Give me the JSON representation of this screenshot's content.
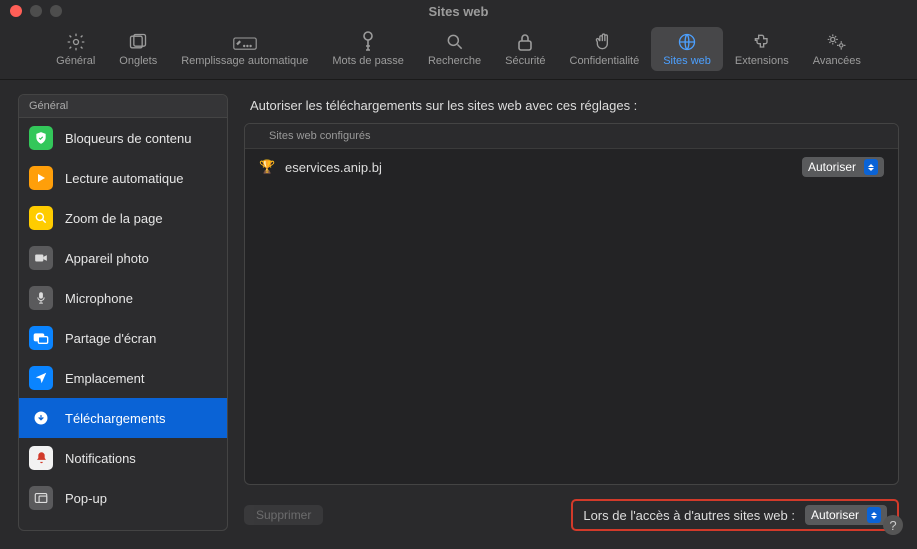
{
  "window": {
    "title": "Sites web"
  },
  "toolbar": {
    "tabs": [
      {
        "label": "Général"
      },
      {
        "label": "Onglets"
      },
      {
        "label": "Remplissage automatique"
      },
      {
        "label": "Mots de passe"
      },
      {
        "label": "Recherche"
      },
      {
        "label": "Sécurité"
      },
      {
        "label": "Confidentialité"
      },
      {
        "label": "Sites web"
      },
      {
        "label": "Extensions"
      },
      {
        "label": "Avancées"
      }
    ]
  },
  "sidebar": {
    "header": "Général",
    "items": [
      {
        "label": "Bloqueurs de contenu"
      },
      {
        "label": "Lecture automatique"
      },
      {
        "label": "Zoom de la page"
      },
      {
        "label": "Appareil photo"
      },
      {
        "label": "Microphone"
      },
      {
        "label": "Partage d'écran"
      },
      {
        "label": "Emplacement"
      },
      {
        "label": "Téléchargements"
      },
      {
        "label": "Notifications"
      },
      {
        "label": "Pop-up"
      }
    ]
  },
  "main": {
    "heading": "Autoriser les téléchargements sur les sites web avec ces réglages :",
    "table_header": "Sites web configurés",
    "rows": [
      {
        "domain": "eservices.anip.bj",
        "value": "Autoriser"
      }
    ],
    "remove_label": "Supprimer",
    "default_label": "Lors de l'accès à d'autres sites web :",
    "default_value": "Autoriser"
  }
}
